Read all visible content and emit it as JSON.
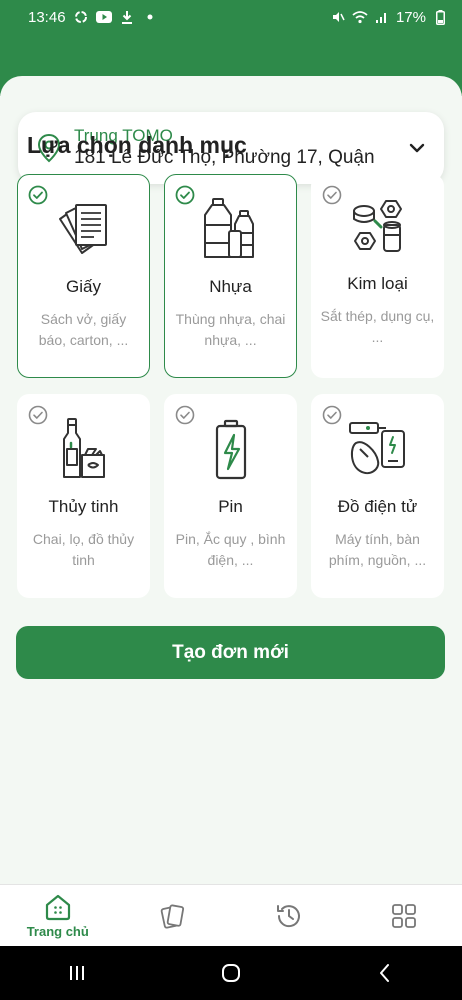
{
  "status_bar": {
    "time": "13:46",
    "battery": "17%"
  },
  "address": {
    "name": "Trung TOMO",
    "line": "181 Lê Đức Thọ, Phường 17, Quận"
  },
  "section_title": "Lựa chọn danh mục",
  "categories": [
    {
      "name": "Giấy",
      "desc": "Sách vở, giấy báo, carton, ...",
      "selected": true,
      "icon": "paper-icon"
    },
    {
      "name": "Nhựa",
      "desc": "Thùng nhựa, chai nhựa, ...",
      "selected": true,
      "icon": "plastic-bottle-icon"
    },
    {
      "name": "Kim loại",
      "desc": "Sắt thép, dụng cụ, ...",
      "selected": false,
      "icon": "metal-icon"
    },
    {
      "name": "Thủy tinh",
      "desc": "Chai, lọ, đồ thủy tinh",
      "selected": false,
      "icon": "glass-icon"
    },
    {
      "name": "Pin",
      "desc": "Pin, Ắc quy , bình điện, ...",
      "selected": false,
      "icon": "battery-icon"
    },
    {
      "name": "Đồ điện tử",
      "desc": "Máy tính, bàn phím, nguồn, ...",
      "selected": false,
      "icon": "electronics-icon"
    }
  ],
  "cta_label": "Tạo đơn mới",
  "bottom_nav": {
    "home_label": "Trang chủ"
  },
  "colors": {
    "primary": "#2e8a4a",
    "background": "#f3f8f3",
    "muted_text": "#9a9a9a"
  }
}
